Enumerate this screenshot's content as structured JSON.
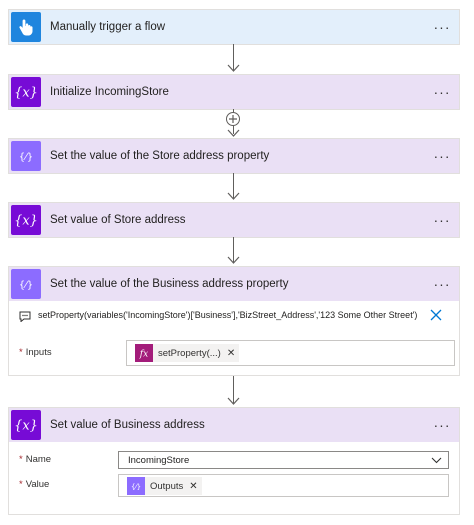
{
  "steps": {
    "trigger": {
      "title": "Manually trigger a flow",
      "icon": "hand-pointer-icon",
      "more": "···"
    },
    "init_store": {
      "title": "Initialize IncomingStore",
      "icon": "variable-icon",
      "more": "···"
    },
    "set_store_prop": {
      "title": "Set the value of the Store address property",
      "icon": "data-operation-icon",
      "more": "···"
    },
    "set_store_addr": {
      "title": "Set value of Store address",
      "icon": "variable-icon",
      "more": "···"
    },
    "set_business_prop": {
      "title": "Set the value of the Business address property",
      "icon": "data-operation-icon",
      "more": "···",
      "expression": "setProperty(variables('IncomingStore')['Business'],'BizStreet_Address','123 Some Other Street')",
      "inputs_label": "Inputs",
      "inputs_token": "setProperty(...)"
    },
    "set_business_addr": {
      "title": "Set value of Business address",
      "icon": "variable-icon",
      "more": "···",
      "name_label": "Name",
      "name_value": "IncomingStore",
      "value_label": "Value",
      "value_token": "Outputs"
    }
  },
  "required_mark": "*",
  "colors": {
    "trigger_header": "#e3effb",
    "action_header": "#eae0f5",
    "trigger_icon": "#1f85de",
    "variable_icon": "#770bd6",
    "data_icon": "#8c6cff",
    "expression_icon": "#a31c7a",
    "close_blue": "#0078d4"
  }
}
